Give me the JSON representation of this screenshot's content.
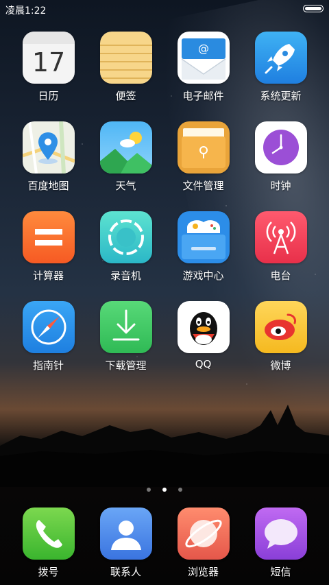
{
  "status_bar": {
    "time": "凌晨1:22"
  },
  "apps": [
    {
      "label": "日历",
      "icon": "calendar-icon",
      "day": "17"
    },
    {
      "label": "便签",
      "icon": "notes-icon"
    },
    {
      "label": "电子邮件",
      "icon": "email-icon"
    },
    {
      "label": "系统更新",
      "icon": "rocket-icon"
    },
    {
      "label": "百度地图",
      "icon": "map-pin-icon"
    },
    {
      "label": "天气",
      "icon": "weather-icon"
    },
    {
      "label": "文件管理",
      "icon": "folder-icon"
    },
    {
      "label": "时钟",
      "icon": "clock-icon"
    },
    {
      "label": "计算器",
      "icon": "calculator-icon"
    },
    {
      "label": "录音机",
      "icon": "recorder-icon"
    },
    {
      "label": "游戏中心",
      "icon": "gamepad-icon"
    },
    {
      "label": "电台",
      "icon": "radio-tower-icon"
    },
    {
      "label": "指南针",
      "icon": "compass-icon"
    },
    {
      "label": "下载管理",
      "icon": "download-icon"
    },
    {
      "label": "QQ",
      "icon": "qq-penguin-icon"
    },
    {
      "label": "微博",
      "icon": "weibo-icon"
    }
  ],
  "page_indicator": {
    "count": 3,
    "active": 2
  },
  "dock": [
    {
      "label": "拨号",
      "icon": "phone-icon"
    },
    {
      "label": "联系人",
      "icon": "contacts-icon"
    },
    {
      "label": "浏览器",
      "icon": "browser-icon"
    },
    {
      "label": "短信",
      "icon": "message-icon"
    }
  ]
}
